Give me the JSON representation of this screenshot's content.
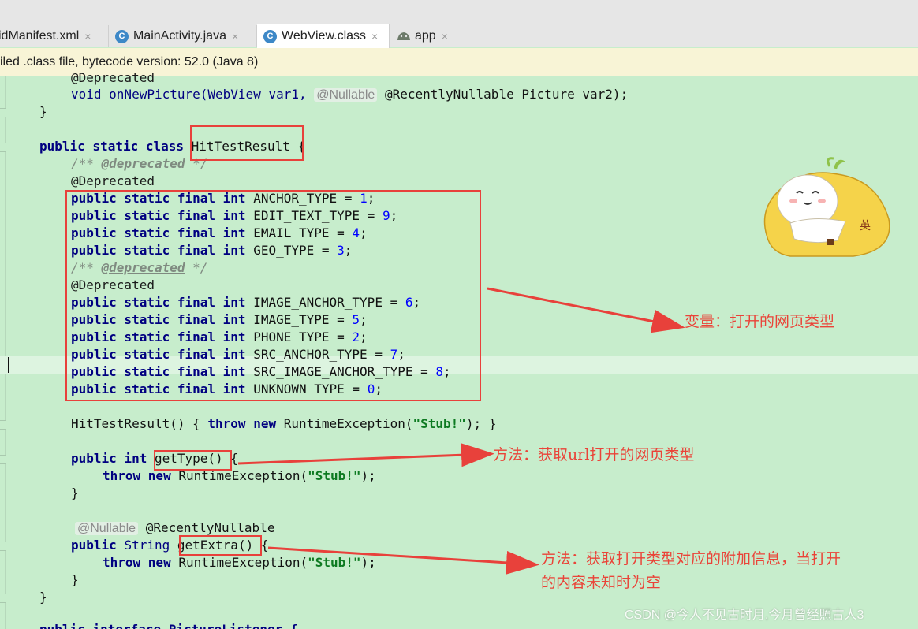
{
  "tabs": [
    {
      "label": "idManifest.xml",
      "icon": "xml-file-icon",
      "active": false
    },
    {
      "label": "MainActivity.java",
      "icon": "java-class-icon",
      "active": false
    },
    {
      "label": "WebView.class",
      "icon": "class-file-icon",
      "active": true
    },
    {
      "label": "app",
      "icon": "android-module-icon",
      "active": false
    }
  ],
  "close_glyph": "×",
  "class_icon_letter": "C",
  "banner_text": "iled .class file, bytecode version: 52.0 (Java 8)",
  "code": {
    "l_deprecated_top": "@Deprecated",
    "l_onNewPicture_a": "void onNewPicture(WebView var1, ",
    "l_onNewPicture_hint": "@Nullable",
    "l_onNewPicture_b": " @RecentlyNullable Picture var2);",
    "l_close1": "}",
    "l_class_kw": "public static class ",
    "l_class_name": "HitTestResult",
    "l_class_brace": " {",
    "l_doc_open": "/** ",
    "l_doc_tag": "@deprecated",
    "l_doc_close": " */",
    "l_deprecated": "@Deprecated",
    "pub": "public static final int ",
    "fields": [
      {
        "name": "ANCHOR_TYPE",
        "value": "1"
      },
      {
        "name": "EDIT_TEXT_TYPE",
        "value": "9"
      },
      {
        "name": "EMAIL_TYPE",
        "value": "4"
      },
      {
        "name": "GEO_TYPE",
        "value": "3"
      },
      {
        "name": "IMAGE_ANCHOR_TYPE",
        "value": "6"
      },
      {
        "name": "IMAGE_TYPE",
        "value": "5"
      },
      {
        "name": "PHONE_TYPE",
        "value": "2"
      },
      {
        "name": "SRC_ANCHOR_TYPE",
        "value": "7"
      },
      {
        "name": "SRC_IMAGE_ANCHOR_TYPE",
        "value": "8"
      },
      {
        "name": "UNKNOWN_TYPE",
        "value": "0"
      }
    ],
    "eq": " = ",
    "semi": ";",
    "ctor_a": "HitTestResult() ",
    "ctor_b": "{ ",
    "ctor_throw": "throw new ",
    "ctor_c": "RuntimeException(",
    "stub": "\"Stub!\"",
    "ctor_d": "); ",
    "ctor_e": "}",
    "gettype_kw": "public int ",
    "gettype_name": "getType()",
    "open_brace": " {",
    "throw_kw": "throw new ",
    "throw_rest": "RuntimeException(",
    "throw_end": ");",
    "close_brace": "}",
    "nullable_hint": "@Nullable",
    "recently": " @RecentlyNullable",
    "getextra_kw": "public ",
    "getextra_type": "String ",
    "getextra_name": "getExtra()",
    "l_last": "public interface PictureListener {"
  },
  "annotations": {
    "variables": "变量：打开的网页类型",
    "get_type": "方法：获取url打开的网页类型",
    "get_extra_1": "方法：获取打开类型对应的附加信息，当打开",
    "get_extra_2": "的内容未知时为空"
  },
  "sticker_glyph": "英",
  "watermark": "CSDN @今人不见古时月,今月曾经照古人3",
  "colors": {
    "background": "#c7edcc",
    "highlight_box": "#e8413b",
    "annotation_text": "#ea4338",
    "keyword": "#000080",
    "number": "#0000ff",
    "string": "#0d7a21"
  }
}
